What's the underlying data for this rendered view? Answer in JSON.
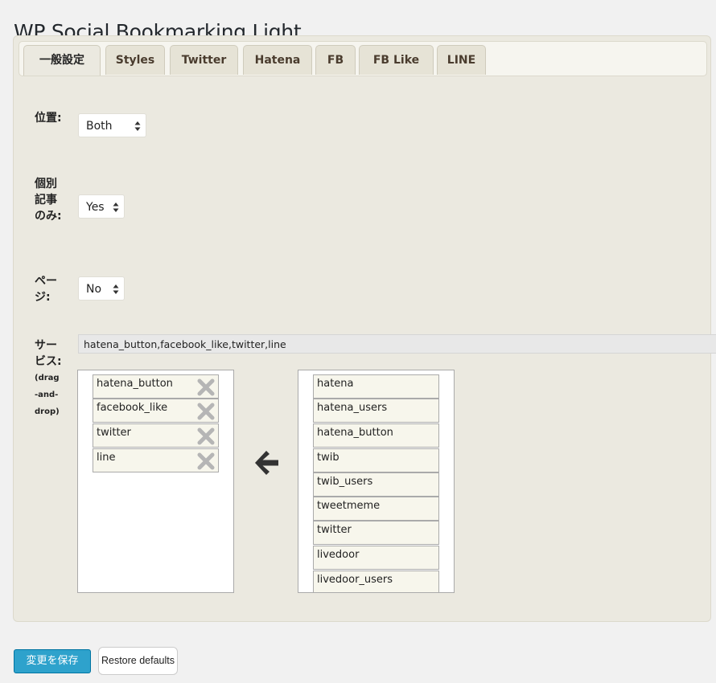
{
  "page": {
    "title": "WP Social Bookmarking Light"
  },
  "tabs": [
    {
      "label": "一般設定",
      "active": true
    },
    {
      "label": "Styles"
    },
    {
      "label": "Twitter"
    },
    {
      "label": "Hatena"
    },
    {
      "label": "FB"
    },
    {
      "label": "FB Like"
    },
    {
      "label": "LINE"
    }
  ],
  "settings": {
    "position": {
      "label": "位置:",
      "value": "Both"
    },
    "single_only": {
      "label": "個別記事のみ:",
      "value": "Yes"
    },
    "page": {
      "label": "ページ:",
      "value": "No"
    },
    "services": {
      "label": "サービス:",
      "sublabel": "(drag-and-drop)",
      "value": "hatena_button,facebook_like,twitter,line"
    }
  },
  "selected_services": [
    "hatena_button",
    "facebook_like",
    "twitter",
    "line"
  ],
  "available_services": [
    "hatena",
    "hatena_users",
    "hatena_button",
    "twib",
    "twib_users",
    "tweetmeme",
    "twitter",
    "livedoor",
    "livedoor_users"
  ],
  "buttons": {
    "save": "変更を保存",
    "restore": "Restore defaults"
  },
  "colors": {
    "primary": "#2ea2cc",
    "panel": "#ebe9e0",
    "item": "#f7f6ec"
  }
}
